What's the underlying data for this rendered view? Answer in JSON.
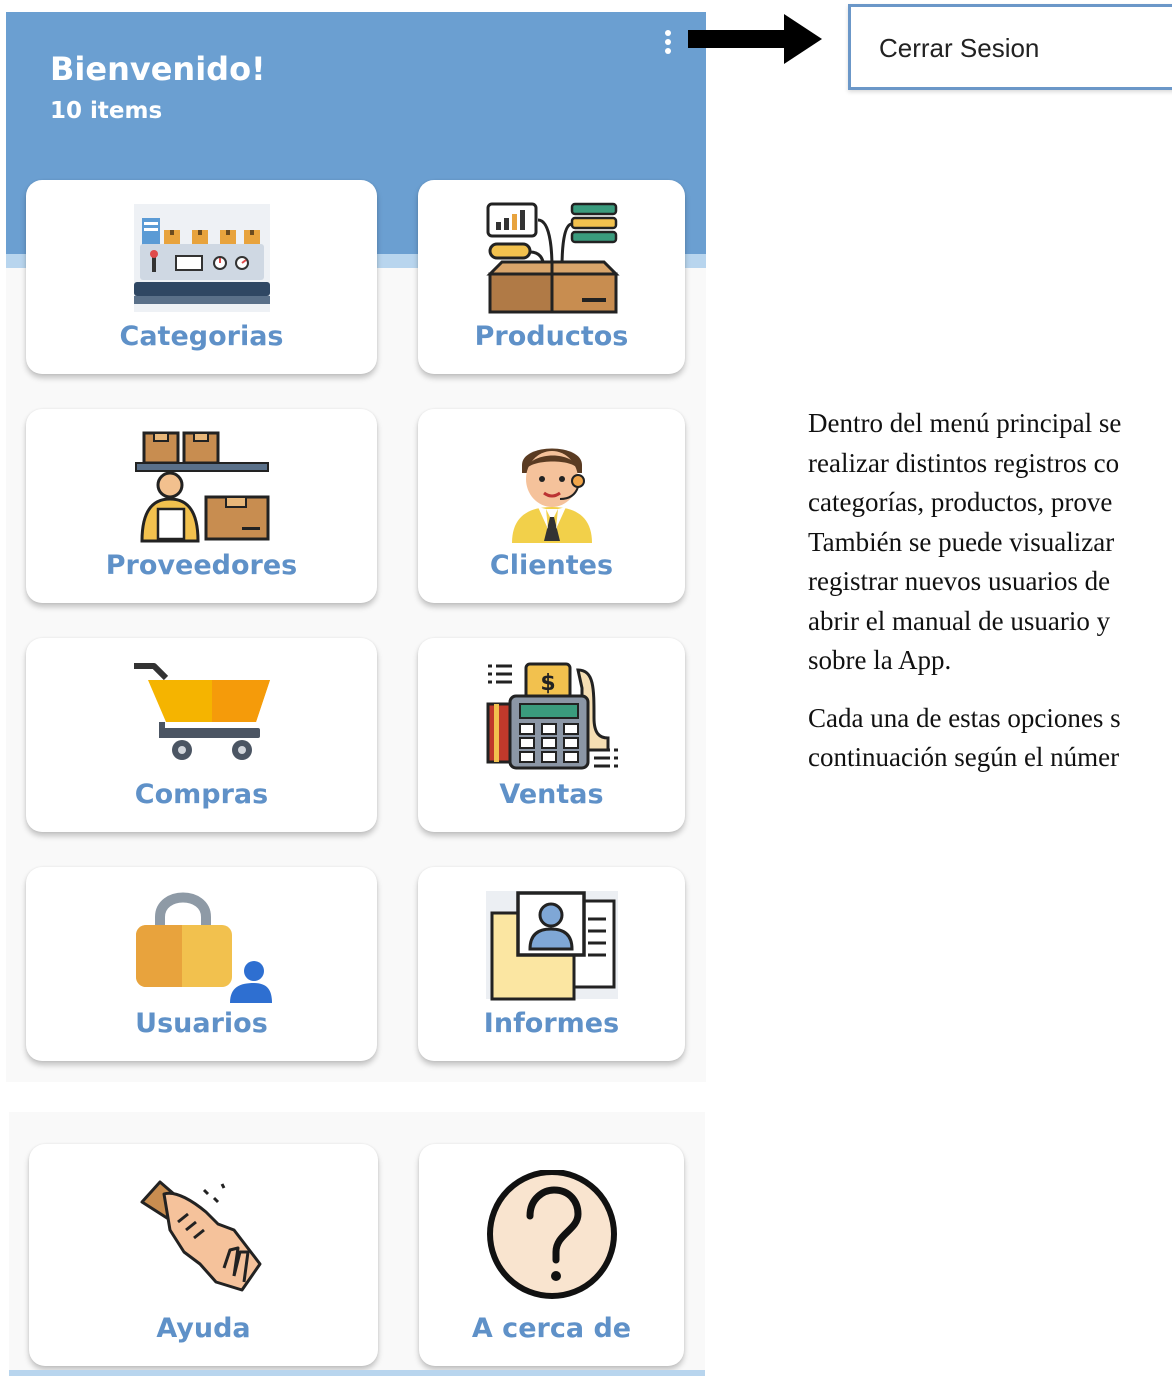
{
  "header": {
    "title": "Bienvenido!",
    "subtitle": "10 items"
  },
  "menu": {
    "items": [
      {
        "label": "Categorias",
        "icon": "factory-conveyor-icon"
      },
      {
        "label": "Productos",
        "icon": "product-box-icon"
      },
      {
        "label": "Proveedores",
        "icon": "supplier-boxes-icon"
      },
      {
        "label": "Clientes",
        "icon": "customer-agent-icon"
      },
      {
        "label": "Compras",
        "icon": "shopping-cart-icon"
      },
      {
        "label": "Ventas",
        "icon": "cash-register-icon"
      },
      {
        "label": "Usuarios",
        "icon": "padlock-user-icon"
      },
      {
        "label": "Informes",
        "icon": "report-folder-icon"
      },
      {
        "label": "Ayuda",
        "icon": "handshake-icon"
      },
      {
        "label": "A cerca de",
        "icon": "question-circle-icon"
      }
    ]
  },
  "overflow_menu": {
    "item": "Cerrar Sesion"
  },
  "description": {
    "paragraph1": [
      "Dentro del menú principal se",
      "realizar distintos registros co",
      "categorías, productos, prove",
      "También se puede visualizar",
      "registrar nuevos usuarios de",
      "abrir el manual de usuario y",
      "sobre la App."
    ],
    "paragraph2": [
      "Cada una de estas opciones s",
      "continuación según el númer"
    ]
  },
  "colors": {
    "header": "#6b9fd1",
    "label": "#5f91c8",
    "popup_border": "#6b97c8"
  }
}
